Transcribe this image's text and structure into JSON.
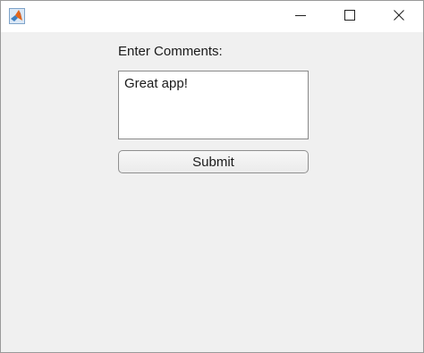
{
  "window": {
    "app_icon": "matlab-icon",
    "controls": {
      "minimize_icon": "minimize-icon",
      "maximize_icon": "maximize-icon",
      "close_icon": "close-icon"
    }
  },
  "form": {
    "comments_label": "Enter Comments:",
    "comments_value": "Great app!",
    "submit_label": "Submit"
  },
  "colors": {
    "background": "#f0f0f0",
    "titlebar": "#ffffff",
    "text": "#1a1a1a"
  }
}
